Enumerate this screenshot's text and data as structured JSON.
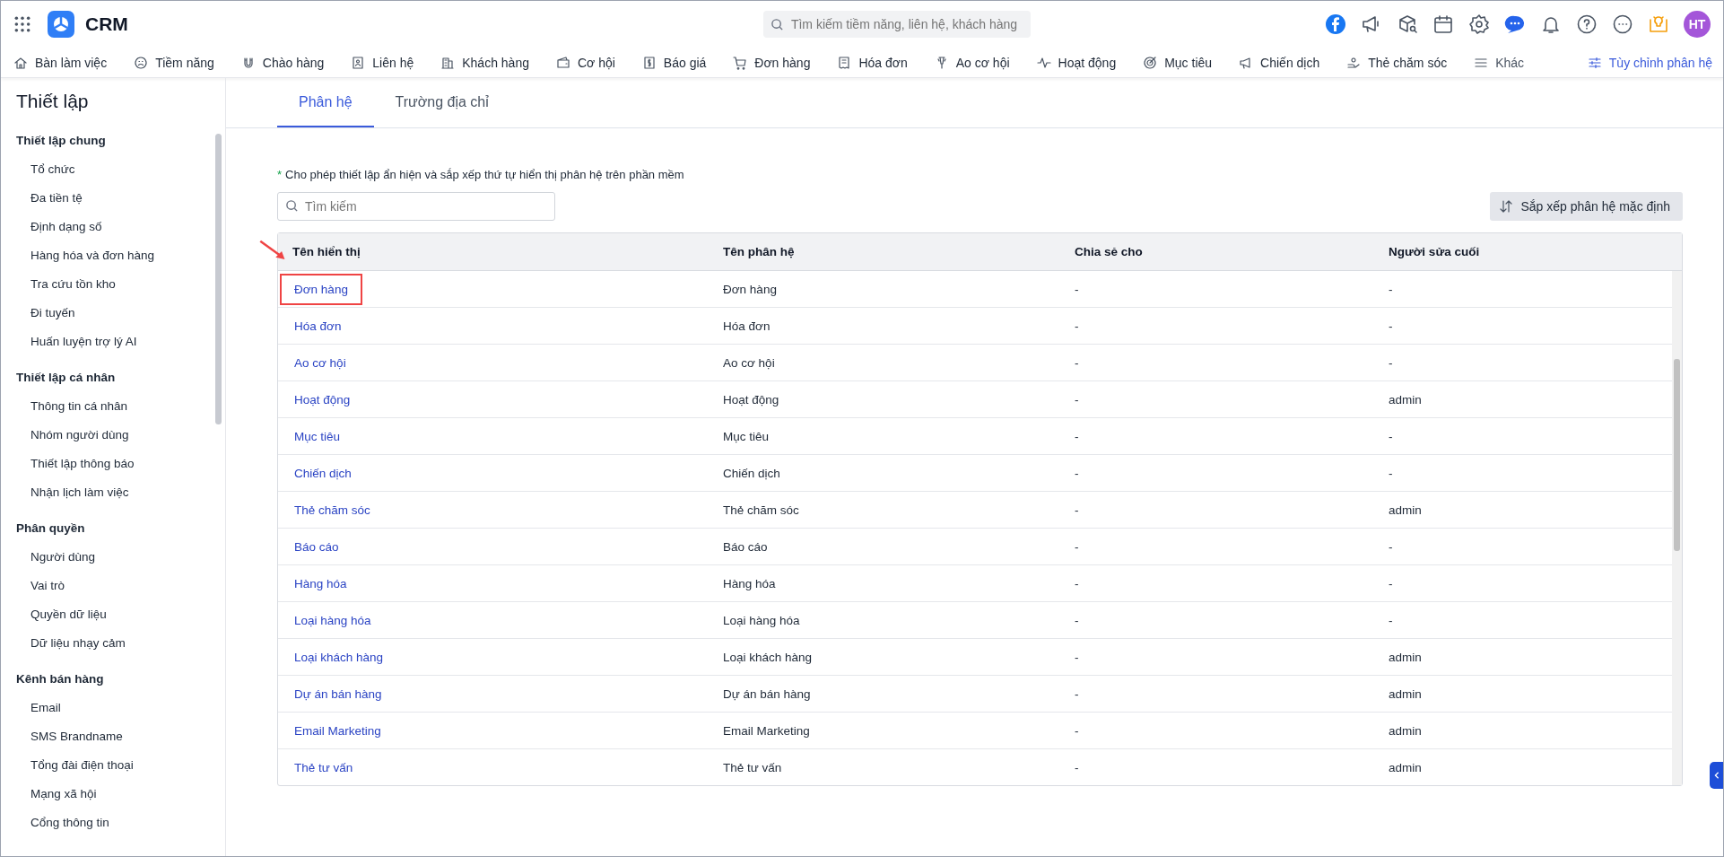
{
  "app": {
    "name": "CRM"
  },
  "search": {
    "placeholder": "Tìm kiếm tiềm năng, liên hệ, khách hàng"
  },
  "user": {
    "initials": "HT"
  },
  "nav": [
    {
      "label": "Bàn làm việc"
    },
    {
      "label": "Tiềm năng"
    },
    {
      "label": "Chào hàng"
    },
    {
      "label": "Liên hệ"
    },
    {
      "label": "Khách hàng"
    },
    {
      "label": "Cơ hội"
    },
    {
      "label": "Báo giá"
    },
    {
      "label": "Đơn hàng"
    },
    {
      "label": "Hóa đơn"
    },
    {
      "label": "Ao cơ hội"
    },
    {
      "label": "Hoạt động"
    },
    {
      "label": "Mục tiêu"
    },
    {
      "label": "Chiến dịch"
    },
    {
      "label": "Thẻ chăm sóc"
    },
    {
      "label": "Khác"
    }
  ],
  "customize": {
    "label": "Tùy chỉnh phân hệ"
  },
  "sidebar": {
    "title": "Thiết lập",
    "groups": [
      {
        "label": "Thiết lập chung",
        "items": [
          "Tổ chức",
          "Đa tiền tệ",
          "Định dạng số",
          "Hàng hóa và đơn hàng",
          "Tra cứu tồn kho",
          "Đi tuyến",
          "Huấn luyện trợ lý AI"
        ]
      },
      {
        "label": "Thiết lập cá nhân",
        "items": [
          "Thông tin cá nhân",
          "Nhóm người dùng",
          "Thiết lập thông báo",
          "Nhận lịch làm việc"
        ]
      },
      {
        "label": "Phân quyền",
        "items": [
          "Người dùng",
          "Vai trò",
          "Quyền dữ liệu",
          "Dữ liệu nhạy cảm"
        ]
      },
      {
        "label": "Kênh bán hàng",
        "items": [
          "Email",
          "SMS Brandname",
          "Tổng đài điện thoại",
          "Mạng xã hội",
          "Cổng thông tin"
        ]
      }
    ]
  },
  "tabs": [
    {
      "label": "Phân hệ",
      "selected": true
    },
    {
      "label": "Trường địa chỉ",
      "selected": false
    }
  ],
  "note": {
    "mark": "*",
    "text": "Cho phép thiết lập ẩn hiện và sắp xếp thứ tự hiển thị phân hệ trên phần mềm"
  },
  "table_search": {
    "placeholder": "Tìm kiếm"
  },
  "sort_button": {
    "label": "Sắp xếp phân hệ mặc định"
  },
  "table": {
    "columns": [
      "Tên hiển thị",
      "Tên phân hệ",
      "Chia sẻ cho",
      "Người sửa cuối"
    ],
    "rows": [
      {
        "display": "Đơn hàng",
        "module": "Đơn hàng",
        "shared": "-",
        "editor": "-",
        "highlighted": true
      },
      {
        "display": "Hóa đơn",
        "module": "Hóa đơn",
        "shared": "-",
        "editor": "-",
        "highlighted": false
      },
      {
        "display": "Ao cơ hội",
        "module": "Ao cơ hội",
        "shared": "-",
        "editor": "-",
        "highlighted": false
      },
      {
        "display": "Hoạt động",
        "module": "Hoạt động",
        "shared": "-",
        "editor": "admin",
        "highlighted": false
      },
      {
        "display": "Mục tiêu",
        "module": "Mục tiêu",
        "shared": "-",
        "editor": "-",
        "highlighted": false
      },
      {
        "display": "Chiến dịch",
        "module": "Chiến dịch",
        "shared": "-",
        "editor": "-",
        "highlighted": false
      },
      {
        "display": "Thẻ chăm sóc",
        "module": "Thẻ chăm sóc",
        "shared": "-",
        "editor": "admin",
        "highlighted": false
      },
      {
        "display": "Báo cáo",
        "module": "Báo cáo",
        "shared": "-",
        "editor": "-",
        "highlighted": false
      },
      {
        "display": "Hàng hóa",
        "module": "Hàng hóa",
        "shared": "-",
        "editor": "-",
        "highlighted": false
      },
      {
        "display": "Loại hàng hóa",
        "module": "Loại hàng hóa",
        "shared": "-",
        "editor": "-",
        "highlighted": false
      },
      {
        "display": "Loại khách hàng",
        "module": "Loại khách hàng",
        "shared": "-",
        "editor": "admin",
        "highlighted": false
      },
      {
        "display": "Dự án bán hàng",
        "module": "Dự án bán hàng",
        "shared": "-",
        "editor": "admin",
        "highlighted": false
      },
      {
        "display": "Email Marketing",
        "module": "Email Marketing",
        "shared": "-",
        "editor": "admin",
        "highlighted": false
      },
      {
        "display": "Thẻ tư vấn",
        "module": "Thẻ tư vấn",
        "shared": "-",
        "editor": "admin",
        "highlighted": false
      }
    ]
  }
}
